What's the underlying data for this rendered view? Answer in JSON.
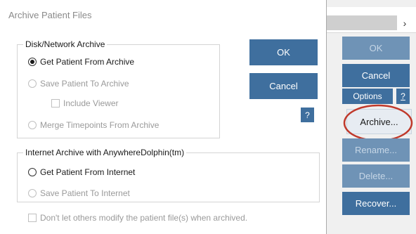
{
  "dialog": {
    "title": "Archive Patient Files",
    "disk_group": {
      "legend": "Disk/Network Archive",
      "options": [
        {
          "label": "Get Patient From Archive",
          "checked": true,
          "enabled": true
        },
        {
          "label": "Save Patient To Archive",
          "checked": false,
          "enabled": false
        },
        {
          "label": "Merge Timepoints From Archive",
          "checked": false,
          "enabled": false
        }
      ],
      "include_viewer": {
        "label": "Include Viewer",
        "checked": false,
        "enabled": false
      }
    },
    "internet_group": {
      "legend": "Internet Archive with AnywhereDolphin(tm)",
      "options": [
        {
          "label": "Get Patient From Internet",
          "checked": false,
          "enabled": true
        },
        {
          "label": "Save Patient To Internet",
          "checked": false,
          "enabled": false
        }
      ]
    },
    "dont_modify": {
      "label": "Don't let others modify the patient file(s) when archived.",
      "checked": false,
      "enabled": false
    },
    "buttons": {
      "ok": "OK",
      "cancel": "Cancel",
      "help": "?"
    }
  },
  "background_window": {
    "chevron": "›",
    "buttons": {
      "ok": "OK",
      "cancel": "Cancel",
      "options": "Options",
      "help": "?",
      "archive": "Archive...",
      "rename": "Rename...",
      "delete": "Delete...",
      "recover": "Recover..."
    }
  },
  "colors": {
    "button_blue": "#3f6f9e",
    "button_disabled": "#6f93b6",
    "highlight_ring": "#c0392b"
  }
}
